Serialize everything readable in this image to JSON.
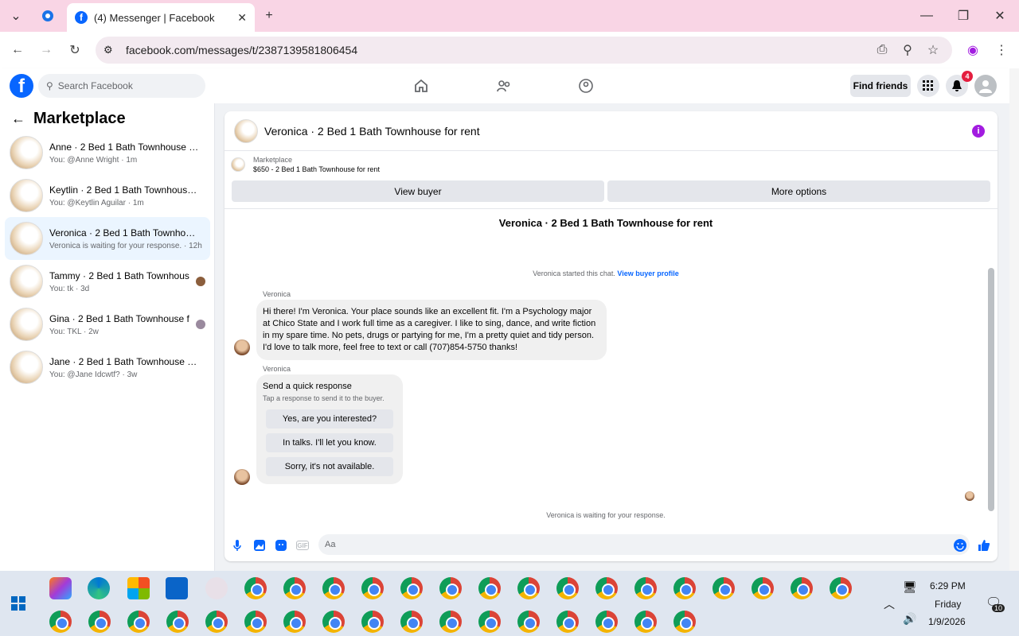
{
  "browser": {
    "tab_title": "(4) Messenger | Facebook",
    "url": "facebook.com/messages/t/2387139581806454"
  },
  "fb": {
    "search_placeholder": "Search Facebook",
    "find_friends": "Find friends",
    "notif_count": "4"
  },
  "sidebar": {
    "title": "Marketplace",
    "items": [
      {
        "title": "Anne · 2 Bed 1 Bath Townhouse fo...",
        "sub": "You: @Anne Wright · 1m"
      },
      {
        "title": "Keytlin · 2 Bed 1 Bath Townhouse f...",
        "sub": "You: @Keytlin Aguilar · 1m"
      },
      {
        "title": "Veronica · 2 Bed 1 Bath Townhouse...",
        "sub": "Veronica is waiting for your response. · 12h"
      },
      {
        "title": "Tammy · 2 Bed 1 Bath Townhous...",
        "sub": "You: tk · 3d"
      },
      {
        "title": "Gina · 2 Bed 1 Bath Townhouse f...",
        "sub": "You: TKL · 2w"
      },
      {
        "title": "Jane · 2 Bed 1 Bath Townhouse for ...",
        "sub": "You: @Jane Idcwtf? · 3w"
      }
    ]
  },
  "chat": {
    "title": "Veronica · 2 Bed 1 Bath Townhouse for rent",
    "marketplace_label": "Marketplace",
    "listing": "$650 - 2 Bed 1 Bath Townhouse for rent",
    "view_buyer": "View buyer",
    "more_options": "More options",
    "header_center": "Veronica · 2 Bed 1 Bath Townhouse for rent",
    "started": "Veronica started this chat.",
    "view_profile": "View buyer profile",
    "sender": "Veronica",
    "message": "Hi there! I'm Veronica. Your place sounds like an excellent fit. I'm a Psychology major at Chico State and I work full time as a caregiver. I like to sing, dance, and write fiction in my spare time. No pets, drugs or partying for me, I'm a pretty quiet and tidy person. I'd love to talk more, feel free to text or call (707)854-5750 thanks!",
    "quick_title": "Send a quick response",
    "quick_sub": "Tap a response to send it to the buyer.",
    "quick_options": [
      "Yes, are you interested?",
      "In talks. I'll let you know.",
      "Sorry, it's not available."
    ],
    "waiting": "Veronica is waiting for your response.",
    "input_placeholder": "Aa"
  },
  "tray": {
    "time": "6:29 PM",
    "day": "Friday",
    "date": "1/9/2026",
    "notif": "10"
  }
}
